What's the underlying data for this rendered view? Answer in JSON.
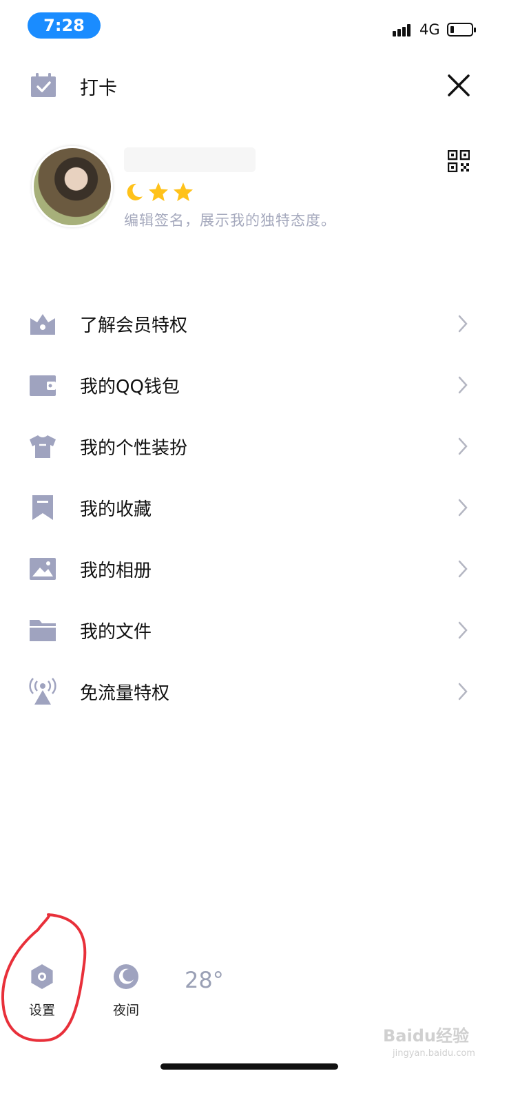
{
  "status_bar": {
    "time": "7:28",
    "network": "4G"
  },
  "header": {
    "checkin_label": "打卡"
  },
  "profile": {
    "nickname": "",
    "signature": "编辑签名，展示我的独特态度。",
    "level_icons": [
      "moon-icon",
      "star-icon",
      "star-icon"
    ]
  },
  "menu": {
    "items": [
      {
        "label": "了解会员特权",
        "icon": "vip-crown-icon"
      },
      {
        "label": "我的QQ钱包",
        "icon": "wallet-icon"
      },
      {
        "label": "我的个性装扮",
        "icon": "tshirt-icon"
      },
      {
        "label": "我的收藏",
        "icon": "bookmark-icon"
      },
      {
        "label": "我的相册",
        "icon": "photo-icon"
      },
      {
        "label": "我的文件",
        "icon": "folder-icon"
      },
      {
        "label": "免流量特权",
        "icon": "signal-tower-icon"
      }
    ]
  },
  "bottom": {
    "settings_label": "设置",
    "night_label": "夜间",
    "temperature": "28°",
    "weather_label": ""
  },
  "watermark": {
    "text": "Baidu经验",
    "sub": "jingyan.baidu.com"
  },
  "colors": {
    "accent": "#1a8cff",
    "icon": "#9fa3bf",
    "annotation": "#e8303a"
  }
}
